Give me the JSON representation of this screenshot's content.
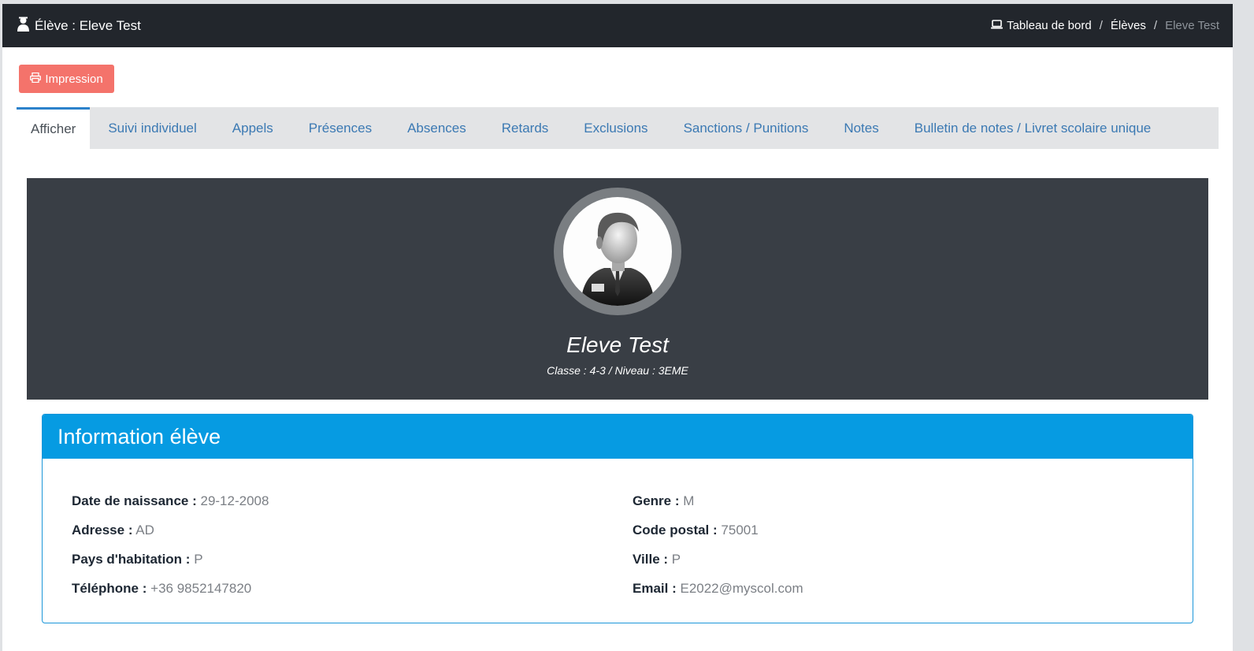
{
  "header": {
    "title": "Élève : Eleve Test",
    "title_icon": "user-graduate-icon",
    "breadcrumb": {
      "home": "Tableau de bord",
      "home_icon": "laptop-icon",
      "section": "Élèves",
      "current": "Eleve Test"
    }
  },
  "toolbar": {
    "print_label": "Impression",
    "print_icon": "printer-icon"
  },
  "tabs": [
    {
      "label": "Afficher",
      "active": true
    },
    {
      "label": "Suivi individuel",
      "active": false
    },
    {
      "label": "Appels",
      "active": false
    },
    {
      "label": "Présences",
      "active": false
    },
    {
      "label": "Absences",
      "active": false
    },
    {
      "label": "Retards",
      "active": false
    },
    {
      "label": "Exclusions",
      "active": false
    },
    {
      "label": "Sanctions / Punitions",
      "active": false
    },
    {
      "label": "Notes",
      "active": false
    },
    {
      "label": "Bulletin de notes / Livret scolaire unique",
      "active": false
    }
  ],
  "profile": {
    "name": "Eleve Test",
    "class_line": "Classe : 4-3 / Niveau : 3EME",
    "avatar_icon": "student-avatar-icon"
  },
  "info": {
    "title": "Information élève",
    "left": [
      {
        "label": "Date de naissance :",
        "value": "29-12-2008"
      },
      {
        "label": "Adresse :",
        "value": "AD"
      },
      {
        "label": "Pays d'habitation :",
        "value": "P"
      },
      {
        "label": "Téléphone :",
        "value": "+36 9852147820"
      }
    ],
    "right": [
      {
        "label": "Genre :",
        "value": "M"
      },
      {
        "label": "Code postal :",
        "value": "75001"
      },
      {
        "label": "Ville :",
        "value": "P"
      },
      {
        "label": "Email :",
        "value": "E2022@myscol.com"
      }
    ]
  },
  "colors": {
    "topbar": "#22262c",
    "print_button": "#f4736b",
    "tab_link": "#3b79b3",
    "banner": "#393e45",
    "card_header": "#069be2"
  }
}
